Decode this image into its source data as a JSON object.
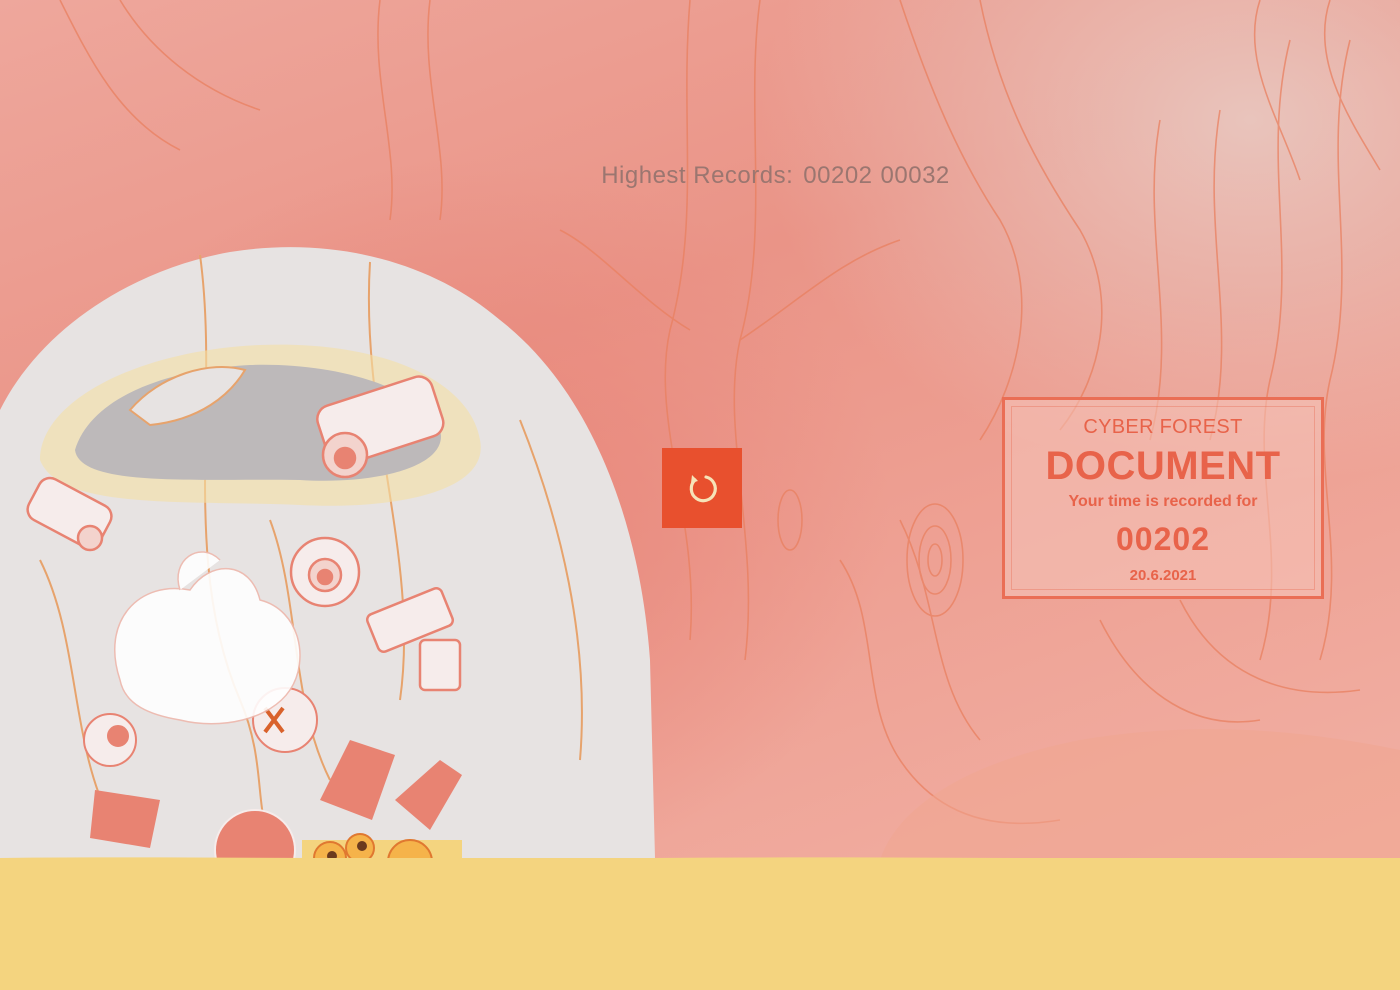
{
  "game": {
    "records": {
      "label": "Highest Records:",
      "values": [
        "00202",
        "00032"
      ]
    },
    "restart": {
      "icon": "restart-icon",
      "color": "#e8502e"
    },
    "document": {
      "eyebrow": "CYBER FOREST",
      "title": "DOCUMENT",
      "subtitle": "Your time is recorded for",
      "time": "00202",
      "date": "20.6.2021"
    }
  },
  "palette": {
    "background": "#ea9487",
    "accent": "#e8634a",
    "ground": "#f4d47f",
    "dome": "#e6e2e1"
  }
}
